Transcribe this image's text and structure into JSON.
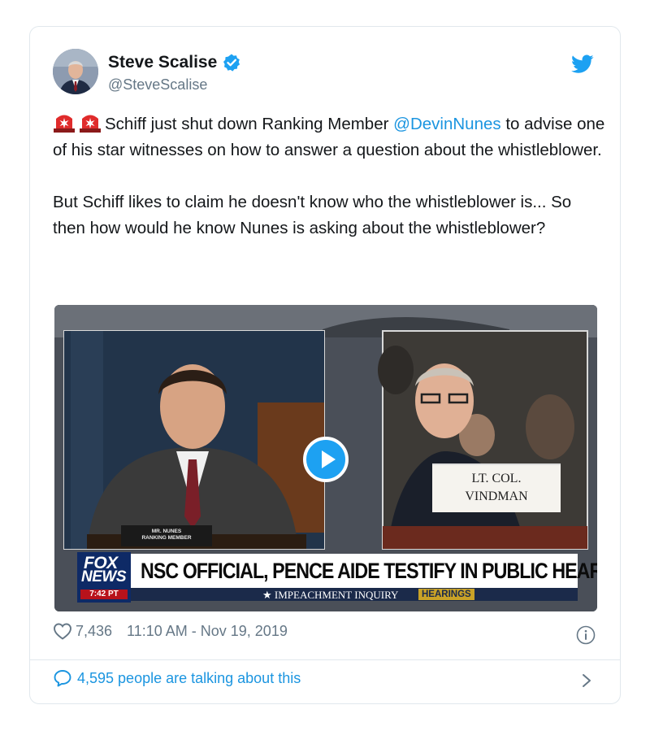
{
  "author": {
    "display_name": "Steve Scalise",
    "handle": "@SteveScalise",
    "verified": true
  },
  "icons": {
    "verified": "verified-badge-icon",
    "brand": "twitter-bird-icon",
    "siren": "police-siren-emoji",
    "like": "heart-icon",
    "info": "info-icon",
    "reply": "speech-bubble-icon",
    "more": "chevron-right-icon",
    "play": "play-icon"
  },
  "tweet": {
    "p1_before_mention": "Schiff just shut down Ranking Member",
    "mention": "@DevinNunes",
    "p1_after_mention": "to advise one of his star witnesses on how to answer a question about the whistleblower.",
    "p2": "But Schiff likes to claim he doesn't know who the whistleblower is... So then how would he know Nunes is asking about the whistleblower?"
  },
  "media": {
    "headline": "NSC OFFICIAL, PENCE AIDE TESTIFY IN PUBLIC HEARING",
    "ticker_text": "★ IMPEACHMENT INQUIRY",
    "ticker_tag": "HEARINGS",
    "ticker_star": "★",
    "logo_line1": "FOX",
    "logo_line2": "NEWS",
    "logo_time": "7:42 PT",
    "nameplate_line1": "LT. COL.",
    "nameplate_line2": "VINDMAN",
    "placard_line1": "MR. NUNES",
    "placard_line2": "RANKING MEMBER"
  },
  "meta": {
    "likes": "7,436",
    "timestamp": "11:10 AM - Nov 19, 2019"
  },
  "footer": {
    "talking": "4,595 people are talking about this"
  },
  "colors": {
    "link_blue": "#1b95e0",
    "twitter_blue": "#1da1f2",
    "secondary_text": "#657786",
    "border": "#e1e8ed",
    "fox_navy": "#0e2a66",
    "fox_red": "#b8121b"
  }
}
